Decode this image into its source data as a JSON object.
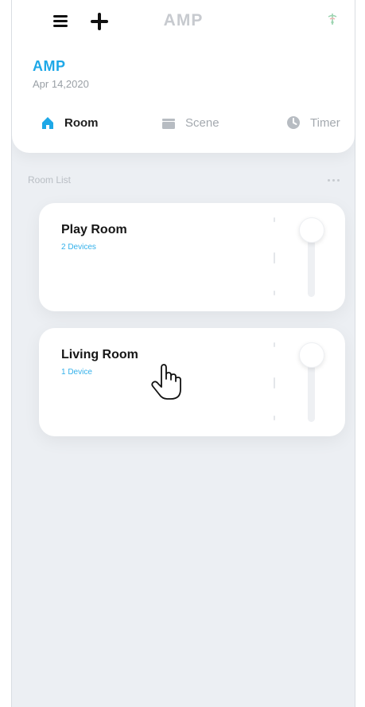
{
  "header": {
    "title": "AMP",
    "menu_icon": "menu-icon",
    "add_icon": "plus-icon",
    "status_icon": "connection-icon"
  },
  "home": {
    "name": "AMP",
    "date": "Apr 14,2020"
  },
  "tabs": [
    {
      "label": "Room",
      "icon": "home-icon",
      "active": true
    },
    {
      "label": "Scene",
      "icon": "scene-icon",
      "active": false
    },
    {
      "label": "Timer",
      "icon": "timer-icon",
      "active": false
    }
  ],
  "room_list": {
    "title": "Room List",
    "more_icon": "more-icon",
    "rooms": [
      {
        "name": "Play Room",
        "devices": "2 Devices"
      },
      {
        "name": "Living Room",
        "devices": "1 Device"
      }
    ]
  },
  "colors": {
    "accent": "#1ea8e7",
    "background": "#eceff3",
    "card": "#ffffff",
    "muted_text": "#a4a9af"
  },
  "cursor": "hand-pointer-icon"
}
